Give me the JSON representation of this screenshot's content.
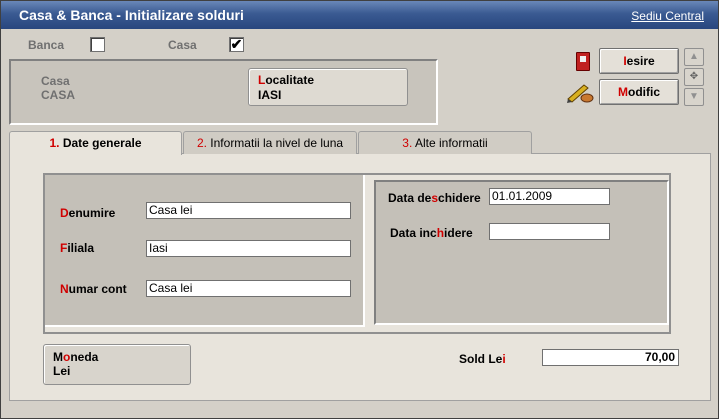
{
  "window": {
    "title": "Casa & Banca - Initializare solduri",
    "link": "Sediu Central"
  },
  "filters": {
    "banca": {
      "label": "Banca",
      "checked": false
    },
    "casa": {
      "label": "Casa",
      "checked": true,
      "mark": "✔"
    }
  },
  "header": {
    "type_label": "Casa",
    "type_value": "CASA",
    "localitate": {
      "hotkey": "L",
      "label_rest": "ocalitate",
      "value": "IASI"
    }
  },
  "actions": {
    "iesire": {
      "hotkey": "I",
      "rest": "esire"
    },
    "modific": {
      "hotkey": "M",
      "rest": "odific"
    }
  },
  "tabs": [
    {
      "num": "1.",
      "label": "Date generale",
      "active": true
    },
    {
      "num": "2.",
      "label": "Informatii la nivel de luna",
      "active": false
    },
    {
      "num": "3.",
      "label": "Alte informatii",
      "active": false
    }
  ],
  "form": {
    "denumire": {
      "hot": "D",
      "rest": "enumire",
      "value": "Casa lei"
    },
    "filiala": {
      "hot": "F",
      "rest": "iliala",
      "value": "Iasi"
    },
    "numar_cont": {
      "hot": "N",
      "rest": "umar cont",
      "value": "Casa lei"
    },
    "data_deschidere": {
      "pre": "Data de",
      "hot": "s",
      "post": "chidere",
      "value": "01.01.2009"
    },
    "data_inchidere": {
      "pre": "Data inc",
      "hot": "h",
      "post": "idere",
      "value": ""
    }
  },
  "moneda": {
    "hot1": "M",
    "hot2": "o",
    "rest": "neda",
    "value": "Lei"
  },
  "sold": {
    "pre": "Sold Le",
    "hot": "i",
    "value": "70,00"
  }
}
